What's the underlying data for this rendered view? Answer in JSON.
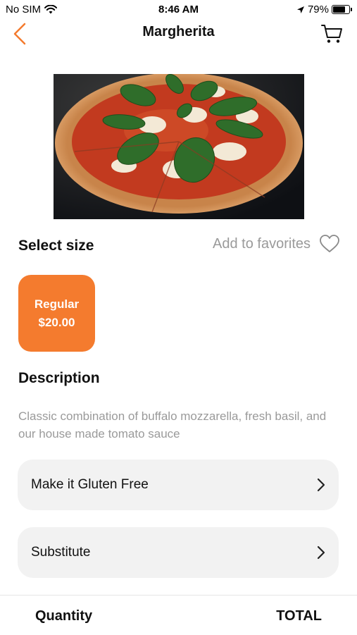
{
  "status_bar": {
    "carrier": "No SIM",
    "time": "8:46 AM",
    "battery": "79%",
    "battery_level": 0.79
  },
  "nav": {
    "title": "Margherita"
  },
  "size": {
    "heading": "Select size",
    "favorites_label": "Add to favorites",
    "options": [
      {
        "name": "Regular",
        "price": "$20.00"
      }
    ]
  },
  "description": {
    "heading": "Description",
    "text": "Classic combination of buffalo mozzarella, fresh basil, and our house made tomato sauce"
  },
  "options": [
    {
      "label": "Make it Gluten Free"
    },
    {
      "label": "Substitute"
    }
  ],
  "footer": {
    "quantity_label": "Quantity",
    "total_label": "TOTAL"
  },
  "colors": {
    "accent": "#f47b2e",
    "muted_text": "#9a9a9a",
    "option_bg": "#f2f2f2"
  }
}
